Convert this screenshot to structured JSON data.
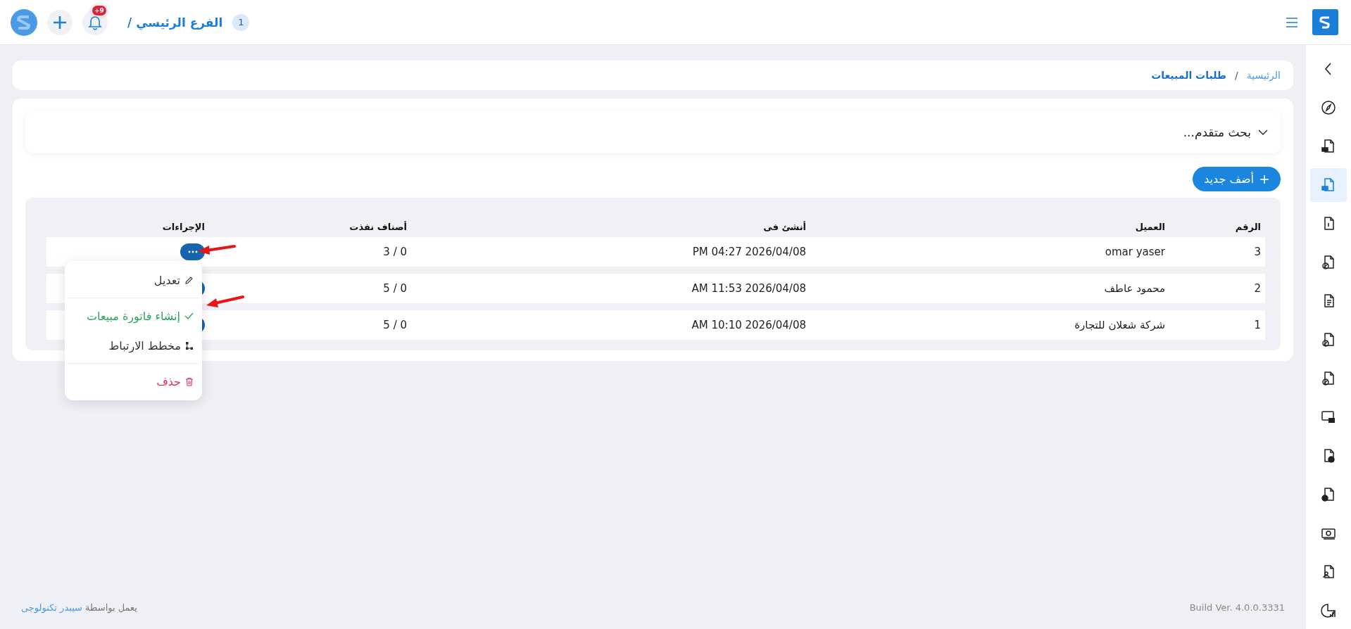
{
  "topbar": {
    "branch_number": "1",
    "branch_name": "الفرع الرئيسي /",
    "notifications_badge": "+9"
  },
  "sidebar": {
    "items": [
      {
        "selected": false
      },
      {
        "selected": false
      },
      {
        "selected": true
      },
      {
        "selected": false
      },
      {
        "selected": false
      },
      {
        "selected": false
      },
      {
        "selected": false
      },
      {
        "selected": false
      },
      {
        "selected": false
      },
      {
        "selected": false
      },
      {
        "selected": false
      },
      {
        "selected": false
      },
      {
        "selected": false
      },
      {
        "selected": false
      }
    ]
  },
  "breadcrumb": {
    "separator": "/",
    "items": [
      {
        "label": "الرئيسية",
        "current": false
      },
      {
        "label": "طلبات المبيعات",
        "current": true
      }
    ]
  },
  "search_panel": {
    "label": "بحث متقدم...",
    "expanded": false
  },
  "add_button": {
    "label": "أضف جديد"
  },
  "table": {
    "columns": [
      "الرقم",
      "العميل",
      "أنشئ فى",
      "أصناف نفذت",
      "الإجراءات"
    ],
    "rows": [
      {
        "number": "3",
        "customer": "omar yaser",
        "created_at": "2026/04/08 04:27 PM",
        "items_done": "0 / 3"
      },
      {
        "number": "2",
        "customer": "محمود عاطف",
        "created_at": "2026/04/08 11:53 AM",
        "items_done": "0 / 5"
      },
      {
        "number": "1",
        "customer": "شركة شعلان للتجارة",
        "created_at": "2026/04/08 10:10 AM",
        "items_done": "0 / 5"
      }
    ]
  },
  "action_menu": {
    "groups": [
      [
        {
          "kind": "edit",
          "label": "تعديل"
        }
      ],
      [
        {
          "kind": "invoice",
          "label": "إنشاء فاتورة مبيعات"
        },
        {
          "kind": "diagram",
          "label": "مخطط الارتباط"
        }
      ],
      [
        {
          "kind": "delete",
          "label": "حذف"
        }
      ]
    ]
  },
  "footer": {
    "build": "Build Ver. 4.0.0.3331",
    "powered_by": "يعمل بواسطة",
    "company": "سيبدر تكنولوجى"
  }
}
